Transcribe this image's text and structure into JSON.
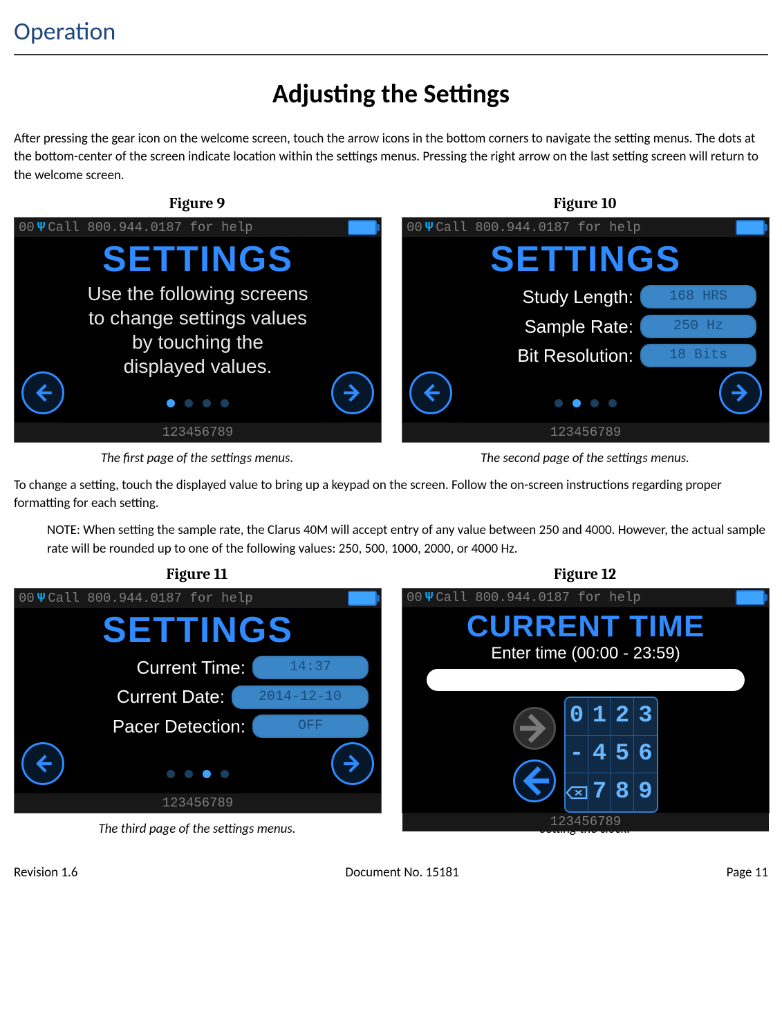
{
  "section": "Operation",
  "title": "Adjusting the Settings",
  "intro": "After pressing the gear icon on the welcome screen, touch the arrow icons in the bottom corners to navigate the setting menus. The dots at the bottom-center of the screen indicate location within the settings menus. Pressing the right arrow on the last setting screen will return to the welcome screen.",
  "mid_para": "To change a setting, touch the displayed value to bring up a keypad on the screen. Follow the on-screen instructions regarding proper formatting for each setting.",
  "note": "NOTE: When setting the sample rate, the Clarus 40M will accept entry of any value between 250 and 4000. However, the actual sample rate will be rounded up to one of the following values: 250, 500, 1000, 2000, or 4000 Hz.",
  "status_prefix": "00",
  "status_text": "Call 800.944.0187 for help",
  "bottom_digits": "123456789",
  "figures": {
    "f9": {
      "label": "Figure 9",
      "heading": "SETTINGS",
      "lines": [
        "Use the following screens",
        "to change settings values",
        "by touching the",
        "displayed values."
      ],
      "caption": "The first page of the settings menus.",
      "active_dot": 0
    },
    "f10": {
      "label": "Figure 10",
      "heading": "SETTINGS",
      "rows": [
        {
          "label": "Study Length:",
          "value": "168 HRS"
        },
        {
          "label": "Sample Rate:",
          "value": "250 Hz"
        },
        {
          "label": "Bit Resolution:",
          "value": "18 Bits"
        }
      ],
      "caption": "The second page of the settings menus.",
      "active_dot": 1
    },
    "f11": {
      "label": "Figure 11",
      "heading": "SETTINGS",
      "rows": [
        {
          "label": "Current Time:",
          "value": "14:37"
        },
        {
          "label": "Current Date:",
          "value": "2014-12-10"
        },
        {
          "label": "Pacer Detection:",
          "value": "OFF"
        }
      ],
      "caption": "The third page of the settings menus.",
      "active_dot": 2
    },
    "f12": {
      "label": "Figure 12",
      "heading": "CURRENT TIME",
      "subheading": "Enter time (00:00 - 23:59)",
      "keys": [
        "0",
        "1",
        "2",
        "3",
        "-",
        "4",
        "5",
        "6",
        "⌫",
        "7",
        "8",
        "9"
      ],
      "caption": "Setting the clock."
    }
  },
  "footer": {
    "left": "Revision 1.6",
    "center": "Document No. 15181",
    "right": "Page 11"
  }
}
